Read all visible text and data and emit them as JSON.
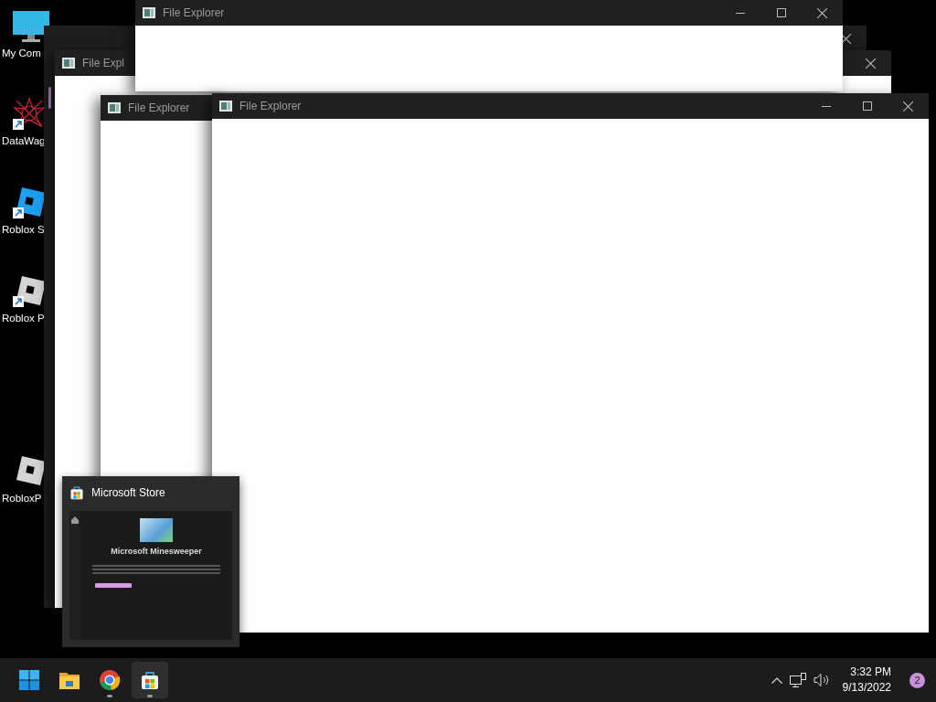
{
  "desktop_icons": [
    {
      "label": "My Com",
      "kind": "computer",
      "shortcut": false
    },
    {
      "label": "DataWag",
      "kind": "burst",
      "shortcut": true
    },
    {
      "label": "Roblox S",
      "kind": "studio",
      "shortcut": true
    },
    {
      "label": "Roblox P",
      "kind": "roblox",
      "shortcut": true
    },
    {
      "label": "RobloxP",
      "kind": "roblox",
      "shortcut": false
    }
  ],
  "windows": [
    {
      "title": "File Expl"
    },
    {
      "title": "File Explorer"
    },
    {
      "title": "File Explorer"
    },
    {
      "title": "File Explorer"
    }
  ],
  "preview": {
    "title": "Microsoft Store",
    "app_title": "Microsoft Minesweeper"
  },
  "taskbar": {
    "apps": [
      {
        "kind": "start",
        "selected": false,
        "running": false
      },
      {
        "kind": "folder",
        "selected": false,
        "running": false
      },
      {
        "kind": "browser",
        "selected": false,
        "running": true
      },
      {
        "kind": "store",
        "selected": true,
        "running": true
      }
    ]
  },
  "clock": {
    "time": "3:32 PM",
    "date": "9/13/2022"
  },
  "notification_count": "2"
}
